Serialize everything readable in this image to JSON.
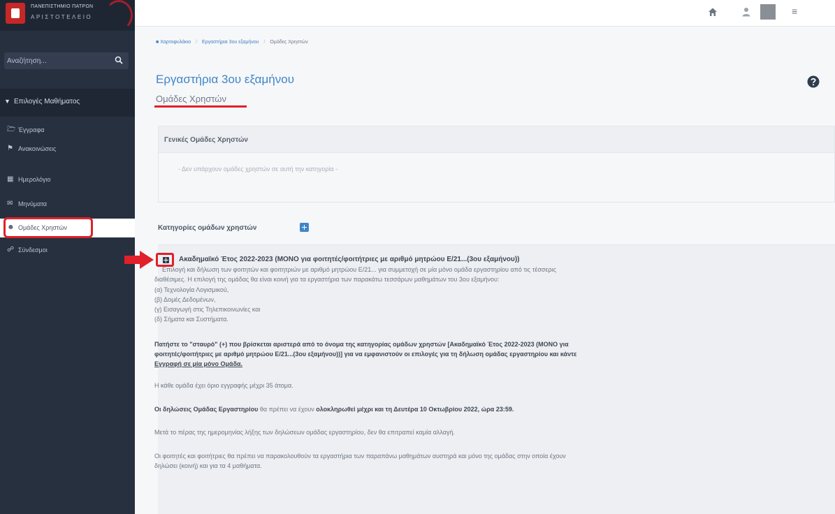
{
  "sidebar": {
    "logo_line1": "ΠΑΝΕΠΙΣΤΗΜΙΟ ΠΑΤΡΩΝ",
    "logo_line2": "ΑΡΙΣΤΟΤΕΛΕΙΟ",
    "search_placeholder": "Αναζήτηση...",
    "course_header": "Επιλογές Μαθήματος",
    "items": [
      {
        "label": "Έγγραφα",
        "icon": "folder-icon"
      },
      {
        "label": "Ανακοινώσεις",
        "icon": "megaphone-icon"
      },
      {
        "label": "Ημερολόγιο",
        "icon": "calendar-icon"
      },
      {
        "label": "Μηνύματα",
        "icon": "envelope-icon"
      },
      {
        "label": "Ομάδες Χρηστών",
        "icon": "users-icon"
      },
      {
        "label": "Σύνδεσμοι",
        "icon": "link-icon"
      }
    ]
  },
  "breadcrumb": [
    "Χαρτοφυλάκιο",
    "Εργαστήρια 3ου εξαμήνου",
    "Ομάδες Χρηστών"
  ],
  "page": {
    "title": "Εργαστήρια 3ου εξαμήνου",
    "subtitle": "Ομάδες Χρηστών"
  },
  "general_groups": {
    "heading": "Γενικές Ομάδες Χρηστών",
    "empty": "- Δεν υπάρχουν ομάδες χρηστών σε αυτή την κατηγορία -"
  },
  "categories": {
    "heading": "Κατηγορίες ομάδων χρηστών",
    "category_name": "Ακαδημαϊκό Έτος 2022-2023 (ΜΟΝΟ για φοιτητές/φοιτήτριες με αριθμό μητρώου Ε/21...(3ου εξαμήνου))",
    "desc_1": "Επιλογή και δήλωση των φοιτητών και φοιτητριών με αριθμό μητρώου Ε/21... για συμμετοχή σε μία μόνο ομάδα εργαστηρίου από τις τέσσερις",
    "desc_2": "διαθέσιμες. Η επιλογή της ομάδας θα είναι κοινή για τα εργαστήρια των παρακάτω τεσσάρων μαθημάτων του 3ου εξαμήνου:",
    "courses": [
      "(α) Τεχνολογία Λογισμικού,",
      "(β) Δομές Δεδομένων,",
      "(γ) Εισαγωγή στις Τηλεπικοινωνίες και",
      "(δ) Σήματα και Συστήματα."
    ],
    "instruction_1": "Πατήστε το \"σταυρό\" (+) που βρίσκεται αριστερά από το όνομα της κατηγορίας ομάδων χρηστών [Ακαδημαϊκό Έτος 2022-2023 (ΜΟΝΟ για",
    "instruction_2": "φοιτητές/φοιτήτριες με αριθμό μητρώου Ε/21...(3ου εξαμήνου))] για να εμφανιστούν οι επιλογές για τη δήλωση ομάδας εργαστηρίου και κάντε",
    "instruction_3": "Εγγραφή σε μία μόνο Ομάδα.",
    "limit": "Η κάθε ομάδα έχει όριο εγγραφής μέχρι 35 άτομα.",
    "deadline_lead": "Οι δηλώσεις Ομάδας Εργαστηρίου",
    "deadline_mid": " θα πρέπει να έχουν ",
    "deadline_bold": "ολοκληρωθεί μέχρι και τη Δευτέρα 10 Οκτωβρίου 2022, ώρα 23:59.",
    "no_change": "Μετά το πέρας της ημερομηνίας λήξης των δηλώσεων ομάδας εργαστηρίου, δεν θα επιτραπεί καμία αλλαγή.",
    "follow_1": "Οι φοιτητές και φοιτήτριες θα πρέπει να παρακολουθούν τα εργαστήρια των παραπάνω μαθημάτων αυστηρά και μόνο της ομάδας στην οποία έχουν",
    "follow_2": "δηλώσει (κοινή) και για τα 4 μαθήματα."
  },
  "colors": {
    "sidebar_bg": "#27303f",
    "accent": "#3d86c6",
    "highlight": "#e0202a"
  }
}
